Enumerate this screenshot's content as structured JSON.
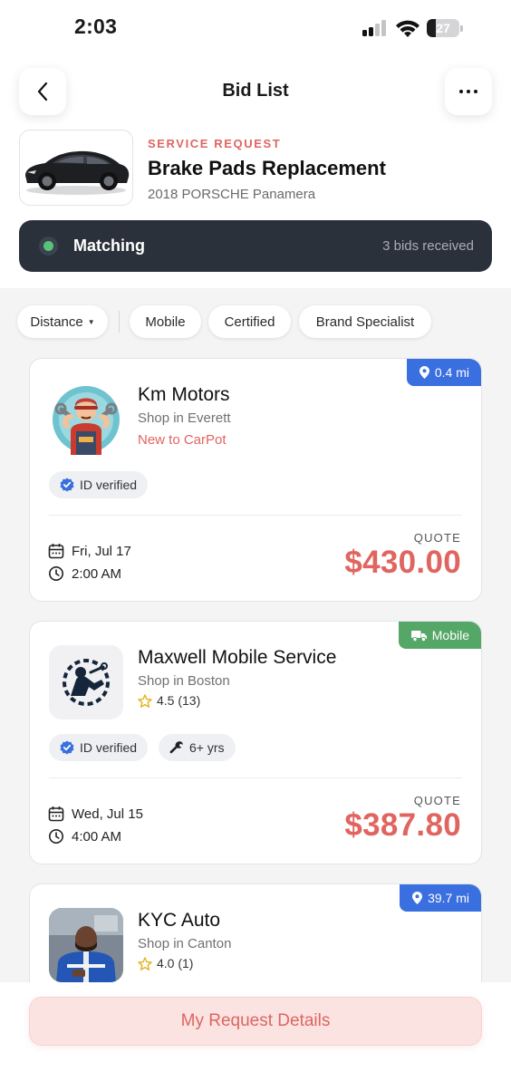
{
  "status_bar": {
    "time": "2:03",
    "battery": "27",
    "battery_level": 0.27
  },
  "header": {
    "title": "Bid List"
  },
  "request": {
    "label": "SERVICE REQUEST",
    "title": "Brake Pads Replacement",
    "vehicle": "2018 PORSCHE Panamera"
  },
  "matching": {
    "label": "Matching",
    "count": "3 bids received"
  },
  "filters": [
    "Distance",
    "Mobile",
    "Certified",
    "Brand Specialist"
  ],
  "bids": [
    {
      "name": "Km Motors",
      "location": "Shop in Everett",
      "note": "New to CarPot",
      "tag": "0.4 mi",
      "badges": [
        "ID verified"
      ],
      "date": "Fri, Jul 17",
      "time": "2:00 AM",
      "quote_label": "QUOTE",
      "quote": "$430.00"
    },
    {
      "name": "Maxwell Mobile Service",
      "location": "Shop in Boston",
      "rating": "4.5 (13)",
      "tag": "Mobile",
      "badges": [
        "ID verified",
        "6+ yrs"
      ],
      "date": "Wed, Jul 15",
      "time": "4:00 AM",
      "quote_label": "QUOTE",
      "quote": "$387.80"
    },
    {
      "name": "KYC Auto",
      "location": "Shop in Canton",
      "rating": "4.0 (1)",
      "tag": "39.7 mi"
    }
  ],
  "cta": {
    "label": "My Request Details"
  },
  "colors": {
    "accent_red": "#e06560",
    "distance_tag_blue": "#3a6fe0",
    "mobile_tag_green": "#55a767",
    "matching_bar": "#2b313b",
    "matching_dot": "#5ac178"
  }
}
